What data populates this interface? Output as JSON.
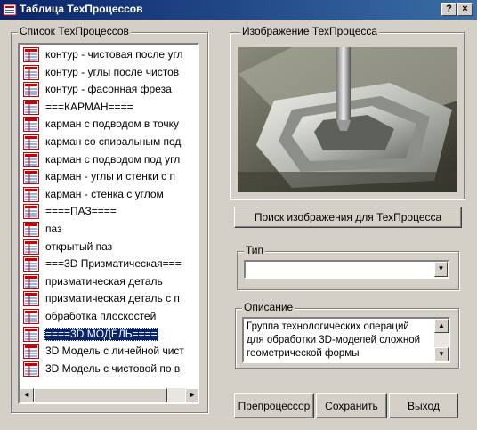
{
  "window": {
    "title": "Таблица ТехПроцессов",
    "help": "?",
    "close": "×"
  },
  "list_group": {
    "label": "Список ТехПроцессов",
    "items": [
      "контур - чистовая после угл",
      "контур - углы после чистов",
      "контур - фасонная фреза",
      "===КАРМАН====",
      "карман с подводом в точку",
      "карман со спиральным под",
      "карман с подводом под угл",
      "карман - углы и стенки с п",
      "карман - стенка с углом",
      "====ПАЗ====",
      "паз",
      "открытый паз",
      "===3D Призматическая===",
      "призматическая деталь",
      "призматическая деталь с п",
      "обработка плоскостей",
      "====3D МОДЕЛЬ====",
      "3D Модель с линейной чист",
      "3D Модель с чистовой по в"
    ],
    "selected_index": 16
  },
  "image_group": {
    "label": "Изображение ТехПроцесса"
  },
  "search_button": "Поиск изображения для ТехПроцесса",
  "type_group": {
    "label": "Тип",
    "value": ""
  },
  "desc_group": {
    "label": "Описание",
    "lines": [
      "Группа технологических операций",
      "для обработки 3D-моделей сложной",
      "геометрической формы"
    ]
  },
  "buttons": {
    "preprocessor": "Препроцессор",
    "save": "Сохранить",
    "exit": "Выход"
  },
  "icons": {
    "list_item": "table-doc-icon",
    "title": "app-icon"
  }
}
